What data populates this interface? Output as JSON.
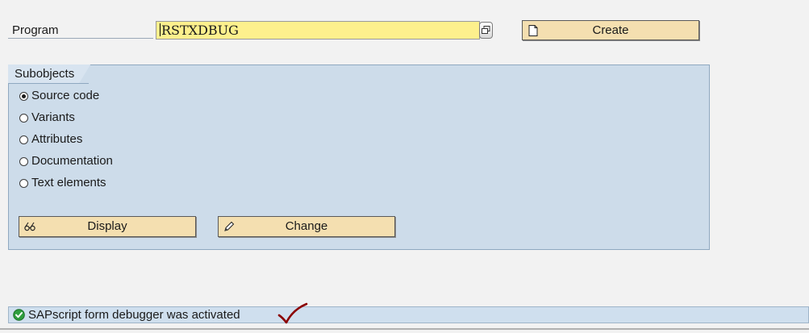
{
  "program": {
    "label": "Program",
    "value": "RSTXDBUG",
    "create_label": "Create"
  },
  "subobjects": {
    "title": "Subobjects",
    "options": [
      {
        "label": "Source code",
        "selected": true
      },
      {
        "label": "Variants",
        "selected": false
      },
      {
        "label": "Attributes",
        "selected": false
      },
      {
        "label": "Documentation",
        "selected": false
      },
      {
        "label": "Text elements",
        "selected": false
      }
    ],
    "display_label": "Display",
    "change_label": "Change"
  },
  "status": {
    "message": "SAPscript form debugger was activated",
    "type": "success"
  },
  "icons": {
    "f4_help": "value-help-icon",
    "create": "new-document-icon",
    "display": "glasses-icon",
    "change": "pencil-icon",
    "status": "success-check-icon",
    "annotation": "red-checkmark-icon"
  },
  "colors": {
    "input_bg": "#fdf08d",
    "button_bg": "#f4dfb0",
    "group_bg": "#cddcea",
    "status_bg": "#cfdfee",
    "success": "#2e9e3e",
    "annotation": "#8b0000"
  }
}
